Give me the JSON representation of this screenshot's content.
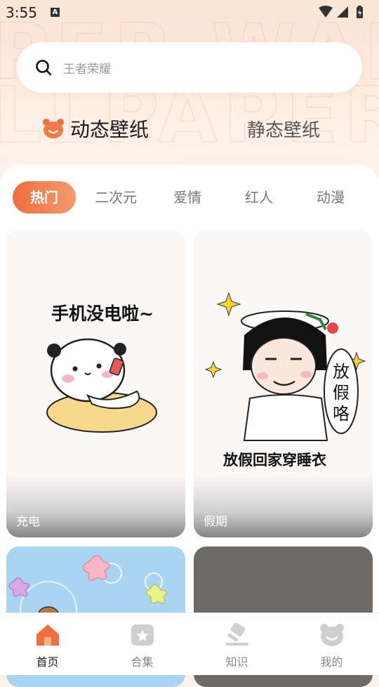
{
  "status_bar": {
    "time": "3:55"
  },
  "search": {
    "placeholder": "王者荣耀"
  },
  "mode_tabs": {
    "dynamic": "动态壁纸",
    "static": "静态壁纸"
  },
  "categories": [
    "热门",
    "二次元",
    "爱情",
    "红人",
    "动漫"
  ],
  "active_category": "热门",
  "wallpapers": [
    {
      "label": "充电",
      "caption": "手机没电啦~"
    },
    {
      "label": "假期",
      "caption": "放假回家穿睡衣"
    },
    {
      "label": ""
    },
    {
      "label": ""
    }
  ],
  "bottom_nav": [
    {
      "label": "首页",
      "icon": "home-icon",
      "active": true
    },
    {
      "label": "合集",
      "icon": "collection-icon",
      "active": false
    },
    {
      "label": "知识",
      "icon": "knowledge-icon",
      "active": false
    },
    {
      "label": "我的",
      "icon": "profile-icon",
      "active": false
    }
  ],
  "colors": {
    "accent": "#ef6f3e",
    "accent_light": "#f39a6c",
    "bg_top": "#fbe4d4"
  }
}
